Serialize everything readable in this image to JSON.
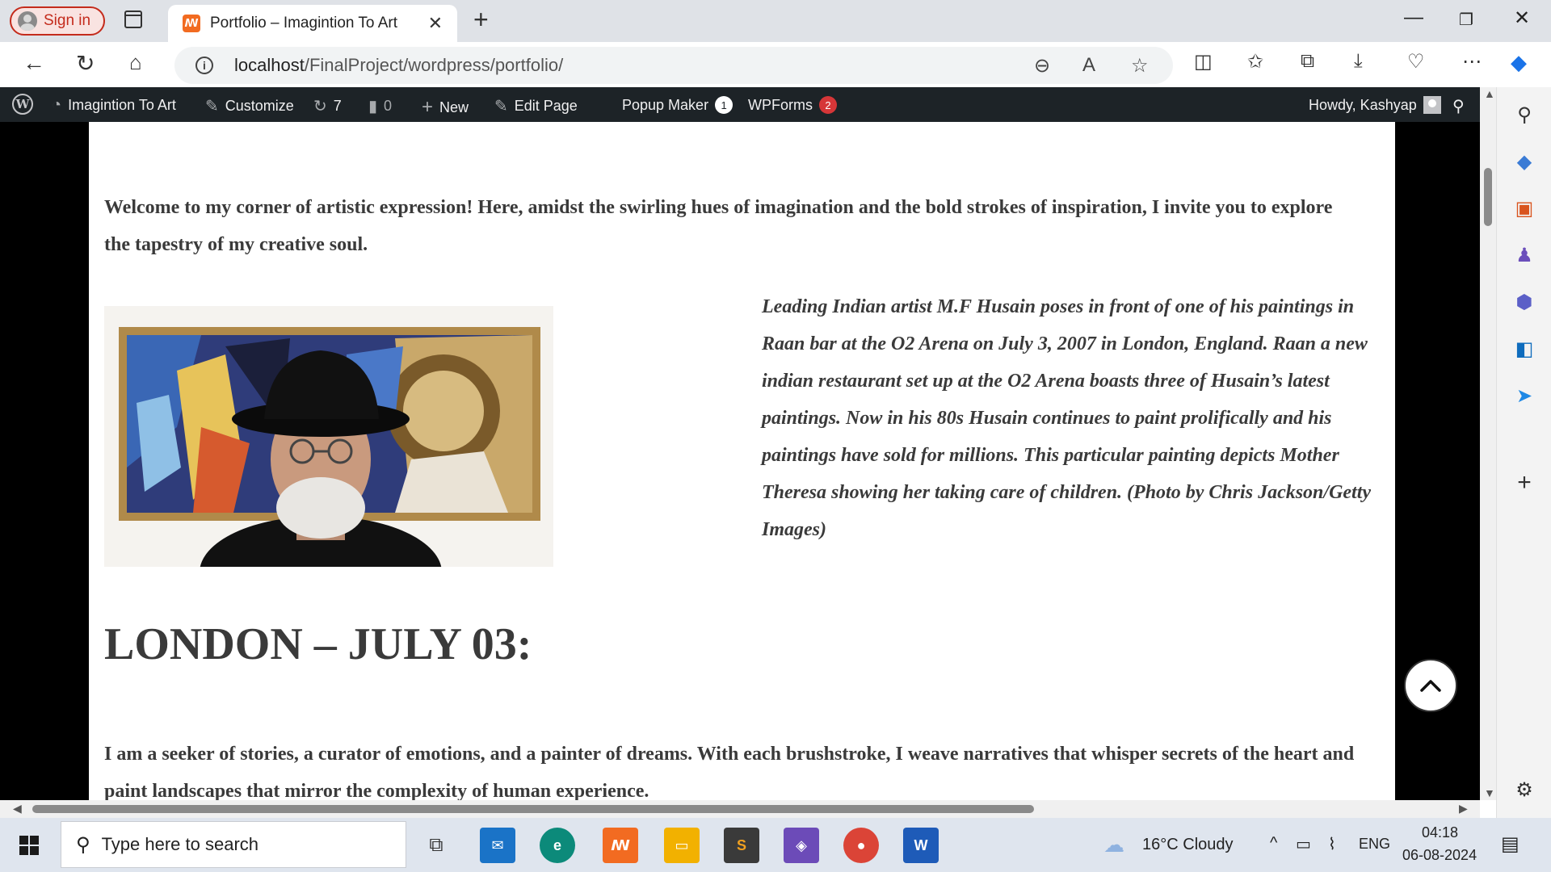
{
  "browser": {
    "sign_in_label": "Sign in",
    "tab_title": "Portfolio – Imagintion To Art",
    "tab_close": "✕",
    "new_tab": "+",
    "url_host": "localhost",
    "url_path": "/FinalProject/wordpress/portfolio/"
  },
  "admin_bar": {
    "site_name": "Imagintion To Art",
    "customize": "Customize",
    "updates_count": "7",
    "comments_count": "0",
    "new_label": "New",
    "edit_page": "Edit Page",
    "popup_maker": "Popup Maker",
    "popup_maker_badge": "1",
    "wpforms": "WPForms",
    "wpforms_badge": "2",
    "howdy": "Howdy, Kashyap"
  },
  "page": {
    "intro": "Welcome to my corner of artistic expression! Here, amidst the swirling hues of imagination and the bold strokes of inspiration, I invite you to explore the tapestry of my creative soul.",
    "caption": "Leading Indian artist M.F Husain poses in front of one of his paintings in Raan bar at the O2 Arena on July 3, 2007 in London, England. Raan a new indian restaurant set up at the O2 Arena boasts three of Husain’s latest paintings. Now in his 80s Husain continues to paint prolifically and his paintings have sold for millions. This particular painting depicts Mother Theresa showing her taking care of children. (Photo by Chris Jackson/Getty Images)",
    "heading": "LONDON – JULY 03:",
    "paragraph": "I am a seeker of stories, a curator of emotions, and a painter of dreams. With each brushstroke, I weave narratives that whisper secrets of the heart and paint landscapes that mirror the complexity of human experience."
  },
  "taskbar": {
    "search_placeholder": "Type here to search",
    "weather": "16°C  Cloudy",
    "language": "ENG",
    "time": "04:18",
    "date": "06-08-2024"
  },
  "colors": {
    "admin_bar_bg": "#1d2327",
    "signin_red": "#c42b1c",
    "badge_red": "#d63638"
  }
}
